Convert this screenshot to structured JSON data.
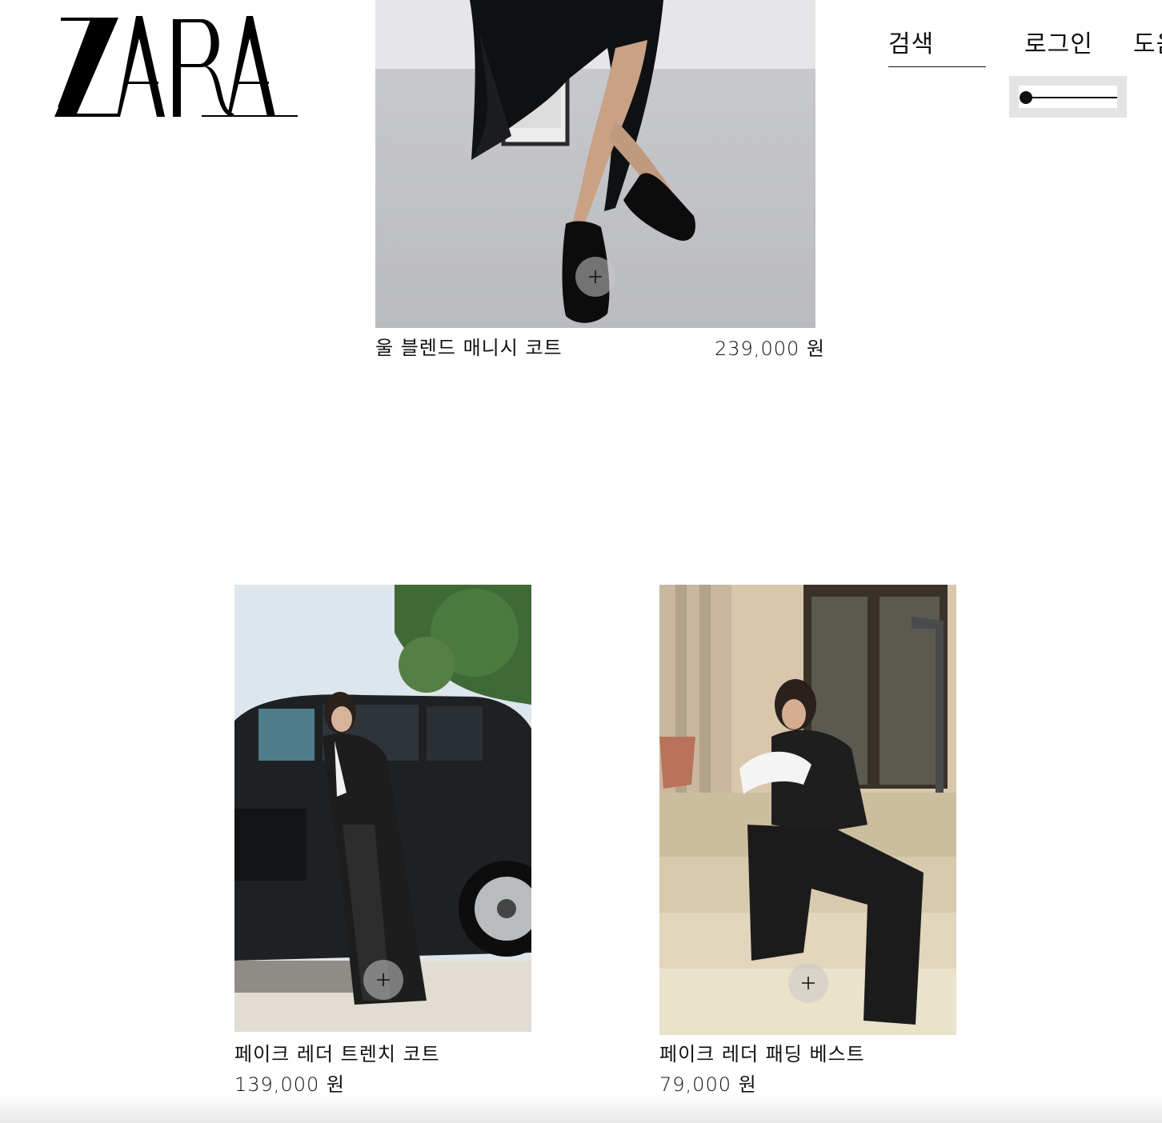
{
  "brand": {
    "logo_text": "ZARA"
  },
  "nav": {
    "search_label": "검색",
    "login_label": "로그인",
    "help_label": "도움말"
  },
  "zoom": {
    "level": 0.0
  },
  "products": [
    {
      "name": "울 블렌드 매니시 코트",
      "price": "239,000 원"
    },
    {
      "name": "페이크 레더 트렌치 코트",
      "price": "139,000 원"
    },
    {
      "name": "페이크 레더 패딩 베스트",
      "price": "79,000 원"
    }
  ],
  "colors": {
    "text": "#111111",
    "background": "#ffffff",
    "widget_bg": "#e4e4e4"
  },
  "icons": {
    "add": "plus-icon"
  }
}
